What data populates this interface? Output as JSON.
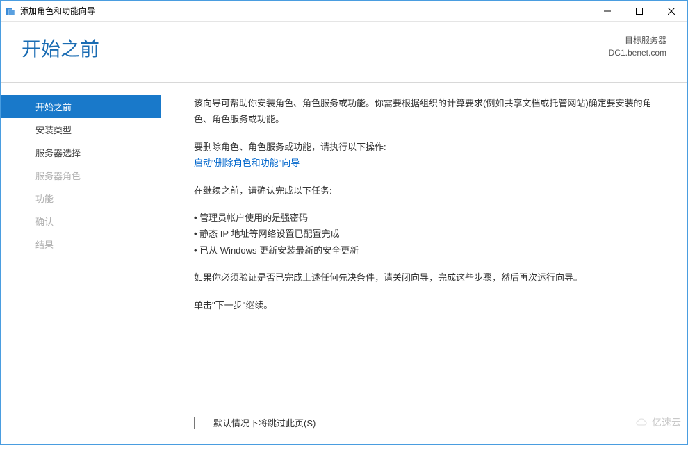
{
  "window": {
    "title": "添加角色和功能向导"
  },
  "header": {
    "pageTitle": "开始之前",
    "destLabel": "目标服务器",
    "destServer": "DC1.benet.com"
  },
  "sidebar": {
    "steps": [
      {
        "label": "开始之前",
        "state": "active"
      },
      {
        "label": "安装类型",
        "state": "enabled"
      },
      {
        "label": "服务器选择",
        "state": "enabled"
      },
      {
        "label": "服务器角色",
        "state": "disabled"
      },
      {
        "label": "功能",
        "state": "disabled"
      },
      {
        "label": "确认",
        "state": "disabled"
      },
      {
        "label": "结果",
        "state": "disabled"
      }
    ]
  },
  "content": {
    "intro": "该向导可帮助你安装角色、角色服务或功能。你需要根据组织的计算要求(例如共享文档或托管网站)确定要安装的角色、角色服务或功能。",
    "removePrompt": "要删除角色、角色服务或功能，请执行以下操作:",
    "removeLink": "启动\"删除角色和功能\"向导",
    "beforeContinue": "在继续之前，请确认完成以下任务:",
    "tasks": [
      "管理员帐户使用的是强密码",
      "静态 IP 地址等网络设置已配置完成",
      "已从 Windows 更新安装最新的安全更新"
    ],
    "verifyNote": "如果你必须验证是否已完成上述任何先决条件，请关闭向导，完成这些步骤，然后再次运行向导。",
    "nextNote": "单击\"下一步\"继续。",
    "skipLabel": "默认情况下将跳过此页(S)"
  },
  "watermark": "亿速云"
}
